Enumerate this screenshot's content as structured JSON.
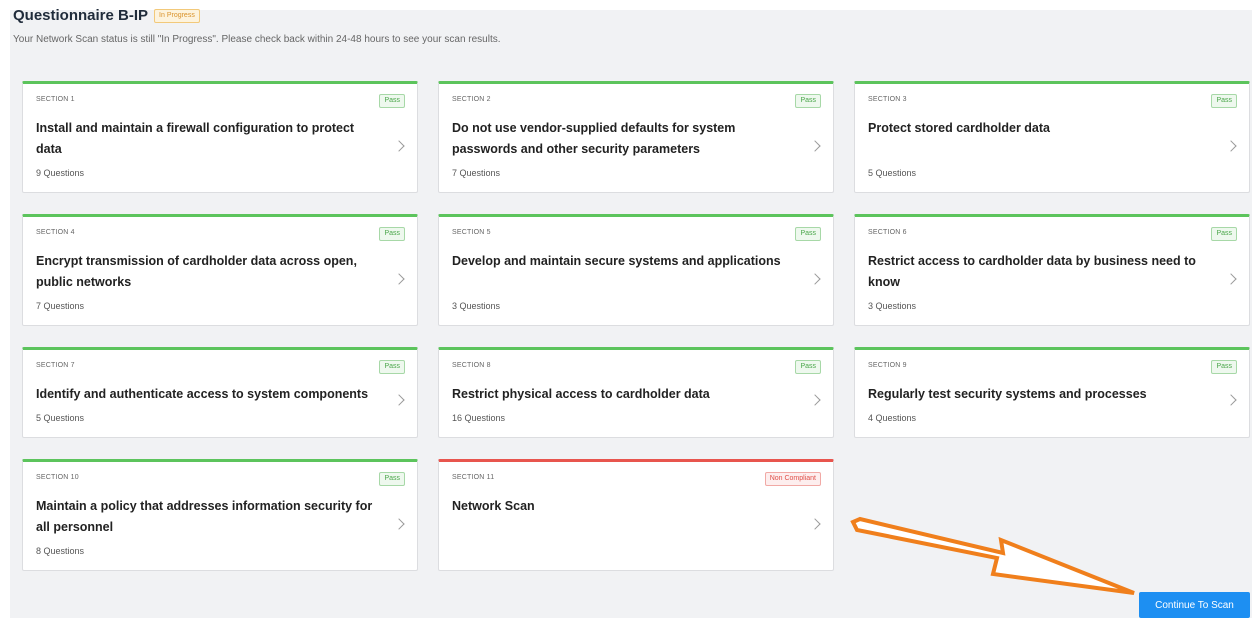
{
  "header": {
    "title": "Questionnaire B-IP",
    "status": "In Progress",
    "subtitle": "Your Network Scan status is still \"In Progress\". Please check back within 24-48 hours to see your scan results."
  },
  "sections": [
    {
      "label": "SECTION 1",
      "title": "Install and maintain a firewall configuration to protect data",
      "questions": "9 Questions",
      "status": "Pass"
    },
    {
      "label": "SECTION 2",
      "title": "Do not use vendor-supplied defaults for system passwords and other security parameters",
      "questions": "7 Questions",
      "status": "Pass"
    },
    {
      "label": "SECTION 3",
      "title": "Protect stored cardholder data",
      "questions": "5 Questions",
      "status": "Pass"
    },
    {
      "label": "SECTION 4",
      "title": "Encrypt transmission of cardholder data across open, public networks",
      "questions": "7 Questions",
      "status": "Pass"
    },
    {
      "label": "SECTION 5",
      "title": "Develop and maintain secure systems and applications",
      "questions": "3 Questions",
      "status": "Pass"
    },
    {
      "label": "SECTION 6",
      "title": "Restrict access to cardholder data by business need to know",
      "questions": "3 Questions",
      "status": "Pass"
    },
    {
      "label": "SECTION 7",
      "title": "Identify and authenticate access to system components",
      "questions": "5 Questions",
      "status": "Pass"
    },
    {
      "label": "SECTION 8",
      "title": "Restrict physical access to cardholder data",
      "questions": "16 Questions",
      "status": "Pass"
    },
    {
      "label": "SECTION 9",
      "title": "Regularly test security systems and processes",
      "questions": "4 Questions",
      "status": "Pass"
    },
    {
      "label": "SECTION 10",
      "title": "Maintain a policy that addresses information security for all personnel",
      "questions": "8 Questions",
      "status": "Pass"
    },
    {
      "label": "SECTION 11",
      "title": "Network Scan",
      "questions": "",
      "status": "Non Compliant"
    }
  ],
  "actions": {
    "continue_label": "Continue To Scan"
  },
  "colors": {
    "pass": "#5cc45c",
    "fail": "#e8554e",
    "primary": "#1d8ff2",
    "annotation_arrow": "#f07f1c"
  },
  "icons": {
    "card_action": "chevron-right-icon",
    "annotation": "arrow-icon"
  }
}
